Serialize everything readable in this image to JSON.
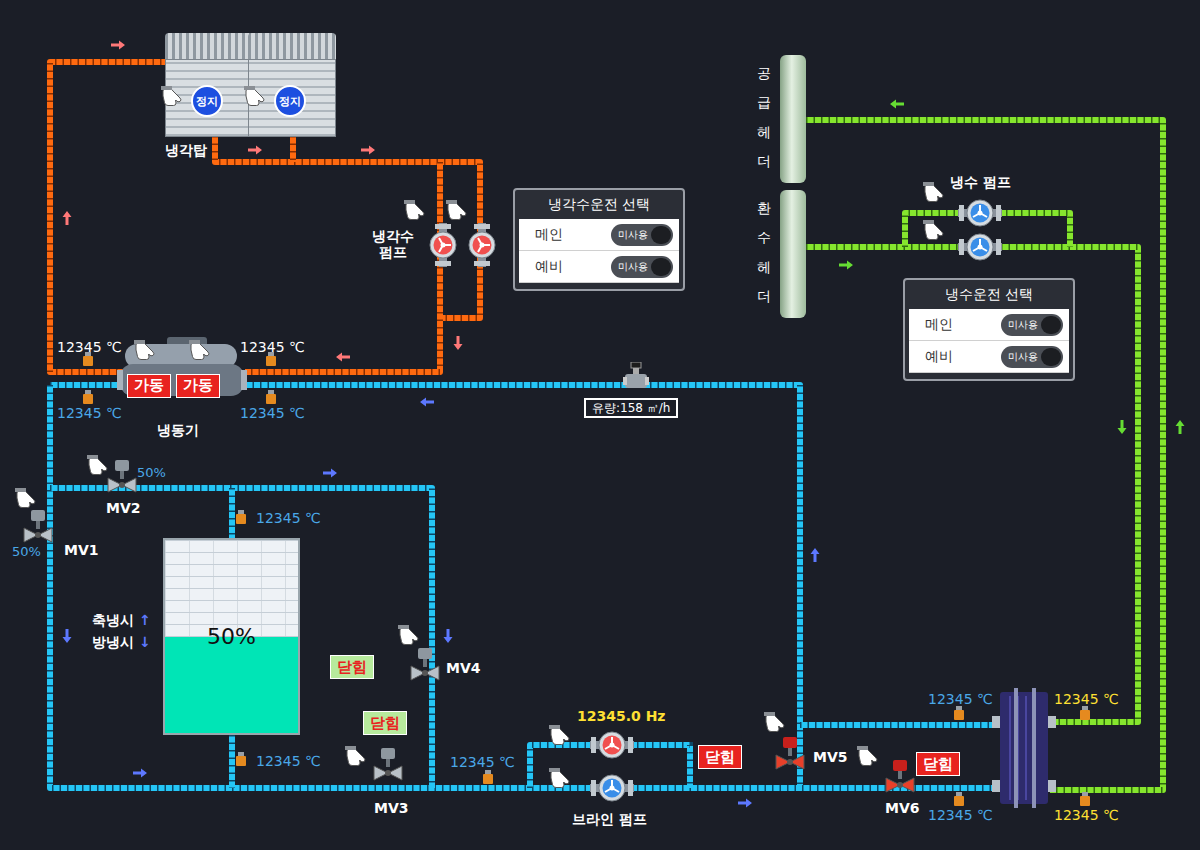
{
  "cooling_tower": {
    "label": "냉각탑",
    "units": [
      {
        "status": "정지",
        "running": false
      },
      {
        "status": "정지",
        "running": false
      }
    ]
  },
  "cooling_water_pump": {
    "label": "냉각수 펌프",
    "pumps": [
      {
        "running": true
      },
      {
        "running": true
      }
    ]
  },
  "chiller": {
    "label": "냉동기",
    "units": [
      {
        "status": "가동",
        "running": true
      },
      {
        "status": "가동",
        "running": true
      }
    ]
  },
  "flow_meter": {
    "reading": "유량:158 ㎥/h"
  },
  "headers": [
    {
      "label": "공급헤더"
    },
    {
      "label": "환수헤더"
    }
  ],
  "chilled_water_pump": {
    "label": "냉수 펌프",
    "pumps": [
      {
        "running": false
      },
      {
        "running": false
      }
    ]
  },
  "brine_pump": {
    "label": "브라인 펌프",
    "frequency": "12345.0 Hz",
    "pumps": [
      {
        "running": true
      },
      {
        "running": false
      }
    ]
  },
  "mode_panels": [
    {
      "title": "냉각수운전 선택",
      "rows": [
        {
          "label": "메인",
          "toggle": "미사용",
          "on": false
        },
        {
          "label": "예비",
          "toggle": "미사용",
          "on": false
        }
      ]
    },
    {
      "title": "냉수운전 선택",
      "rows": [
        {
          "label": "메인",
          "toggle": "미사용",
          "on": false
        },
        {
          "label": "예비",
          "toggle": "미사용",
          "on": false
        }
      ]
    }
  ],
  "valves": [
    {
      "name": "MV1",
      "kind": "modulating",
      "reading": "50%"
    },
    {
      "name": "MV2",
      "kind": "modulating",
      "reading": "50%"
    },
    {
      "name": "MV3",
      "kind": "onoff",
      "status": "닫힘",
      "alarm": false,
      "color": "#b7ea9c"
    },
    {
      "name": "MV4",
      "kind": "onoff",
      "status": "닫힘",
      "alarm": false,
      "color": "#b7ea9c"
    },
    {
      "name": "MV5",
      "kind": "onoff",
      "status": "닫힘",
      "alarm": true,
      "color": "#e8231f"
    },
    {
      "name": "MV6",
      "kind": "onoff",
      "status": "닫힘",
      "alarm": true,
      "color": "#e8231f"
    }
  ],
  "tank": {
    "level": 0.5,
    "reading": "50%",
    "modes": [
      {
        "label": "축냉시",
        "arrow": "↑"
      },
      {
        "label": "방냉시",
        "arrow": "↓"
      }
    ]
  },
  "temperatures": [
    {
      "value": "12345 ℃",
      "color": "#ffffff"
    },
    {
      "value": "12345 ℃",
      "color": "#ffffff"
    },
    {
      "value": "12345 ℃",
      "color": "#4aa8e8"
    },
    {
      "value": "12345 ℃",
      "color": "#4aa8e8"
    },
    {
      "value": "12345 ℃",
      "color": "#4aa8e8"
    },
    {
      "value": "12345 ℃",
      "color": "#4aa8e8"
    },
    {
      "value": "12345 ℃",
      "color": "#4aa8e8"
    },
    {
      "value": "12345 ℃",
      "color": "#4aa8e8"
    },
    {
      "value": "12345 ℃",
      "color": "#ffe033"
    },
    {
      "value": "12345 ℃",
      "color": "#4aa8e8"
    },
    {
      "value": "12345 ℃",
      "color": "#ffe033"
    }
  ]
}
